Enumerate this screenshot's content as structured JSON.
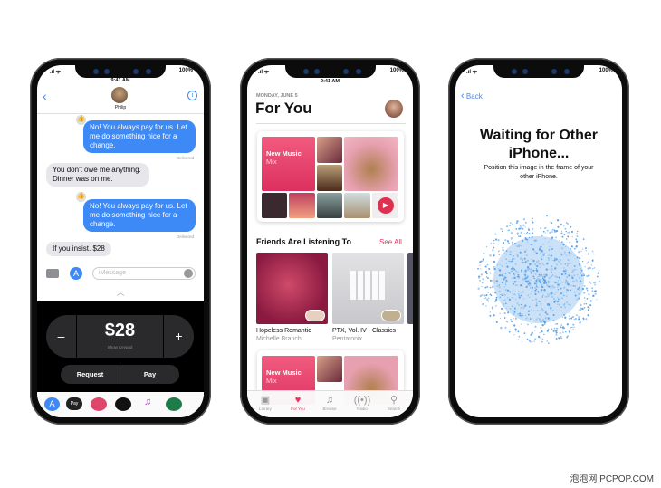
{
  "status": {
    "time": "9:41 AM",
    "battery": "100%"
  },
  "messages": {
    "contact": "Philip",
    "thread": [
      {
        "from": "me",
        "text": "No! You always pay for us. Let me do something nice for a change.",
        "status": "Delivered"
      },
      {
        "from": "them",
        "text": "You don't owe me anything. Dinner was on me."
      },
      {
        "from": "me",
        "text": "No! You always pay for us. Let me do something nice for a change.",
        "status": "Delivered"
      },
      {
        "from": "them",
        "text": "If you insist. $28"
      }
    ],
    "input_placeholder": "iMessage",
    "pay": {
      "amount": "$28",
      "minus": "–",
      "plus": "+",
      "show_keypad": "Show Keypad",
      "request": "Request",
      "pay": "Pay"
    },
    "apple_pay_label": "Pay"
  },
  "music": {
    "date": "MONDAY, JUNE 5",
    "title": "For You",
    "mix_title": "New Music",
    "mix_subtitle": "Mix",
    "friends_heading": "Friends Are Listening To",
    "see_all": "See All",
    "albums": [
      {
        "title": "Hopeless Romantic",
        "artist": "Michelle Branch"
      },
      {
        "title": "PTX, Vol. IV - Classics",
        "artist": "Pentatonix"
      }
    ],
    "tabs": [
      {
        "label": "Library",
        "icon": "library-icon"
      },
      {
        "label": "For You",
        "icon": "heart-icon",
        "active": true
      },
      {
        "label": "Browse",
        "icon": "music-note-icon"
      },
      {
        "label": "Radio",
        "icon": "radio-icon"
      },
      {
        "label": "Search",
        "icon": "search-icon"
      }
    ],
    "accent": "#f0305a"
  },
  "setup": {
    "back": "Back",
    "title_line1": "Waiting for Other",
    "title_line2": "iPhone...",
    "subtitle_line1": "Position this image in the frame of your",
    "subtitle_line2": "other iPhone."
  },
  "watermark": "泡泡网 PCPOP.COM"
}
